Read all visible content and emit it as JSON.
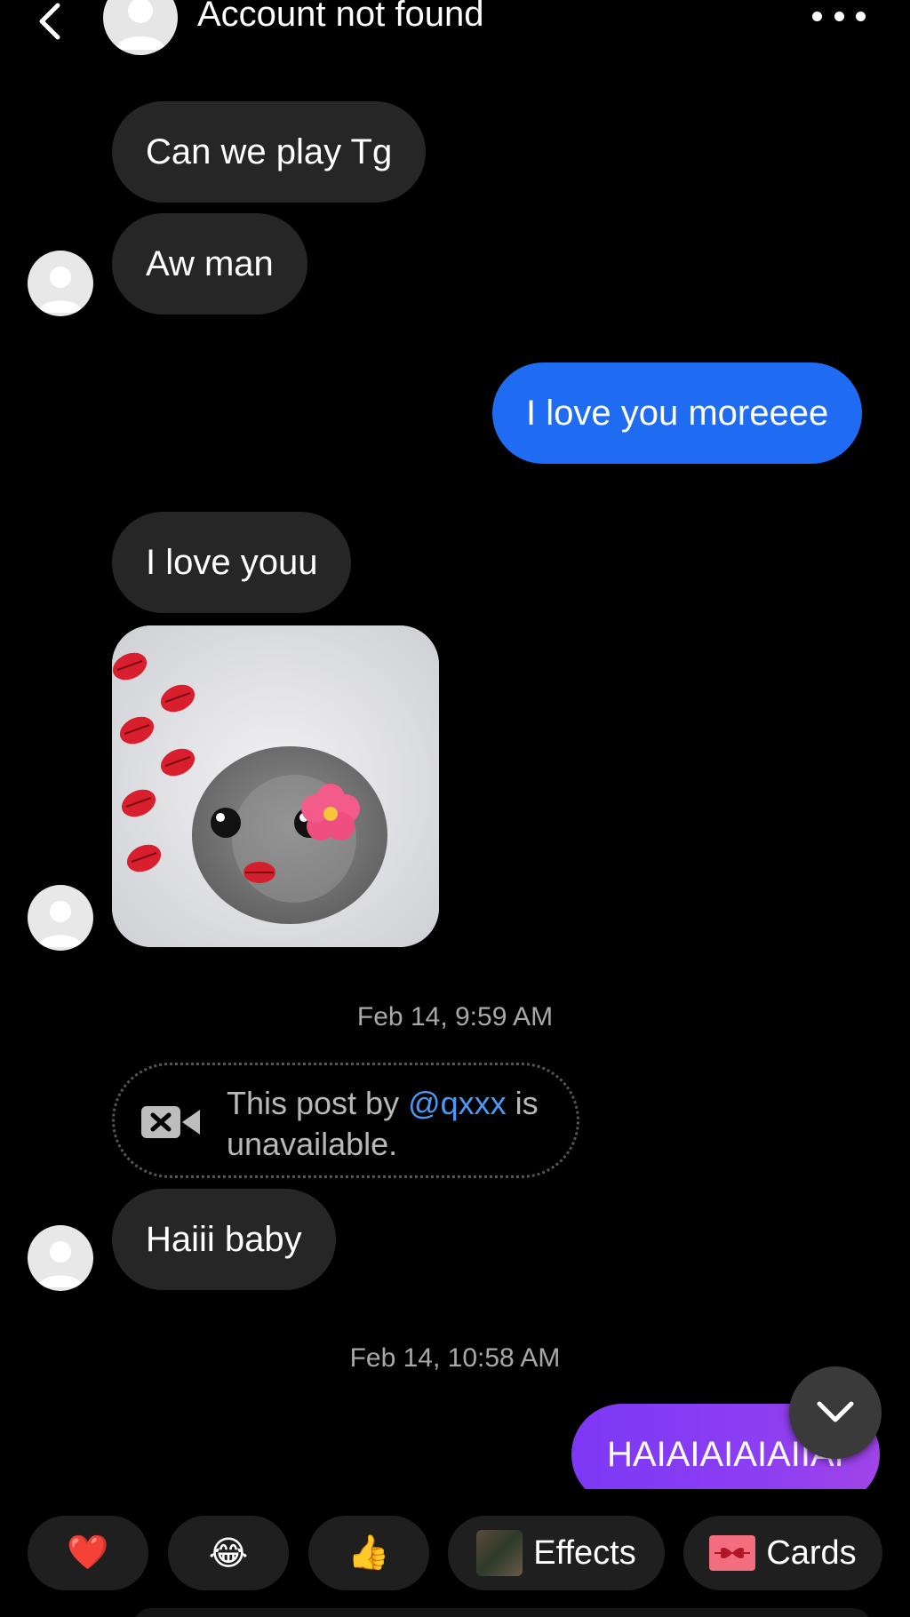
{
  "header": {
    "title": "Account not found",
    "back_icon": "chevron-left-icon",
    "more_icon": "more-horizontal-icon"
  },
  "messages": [
    {
      "direction": "in",
      "type": "text",
      "text": "Can we play Tg"
    },
    {
      "direction": "in",
      "type": "text",
      "text": "Aw man"
    },
    {
      "direction": "out",
      "type": "text",
      "text": "I love you moreeee"
    },
    {
      "direction": "in",
      "type": "text",
      "text": "I love youu"
    },
    {
      "direction": "in",
      "type": "sticker",
      "sticker": "hamster-kiss-sticker"
    }
  ],
  "timestamp_1": "Feb 14, 9:59 AM",
  "unavailable_post": {
    "prefix": "This post by ",
    "mention": "@qxxx",
    "suffix": " is unavailable.",
    "icon": "video-off-icon"
  },
  "message_after_post": {
    "direction": "in",
    "type": "text",
    "text": "Haiii baby"
  },
  "timestamp_2": "Feb 14, 10:58 AM",
  "last_message": {
    "direction": "out",
    "type": "text",
    "text": "HAIAIAIAIAIIAI"
  },
  "quick_bar": {
    "heart": "❤️",
    "laugh": "😂",
    "thumbs": "👍",
    "effects_label": "Effects",
    "cards_label": "Cards"
  },
  "colors": {
    "background": "#000000",
    "incoming_bubble": "#262626",
    "outgoing_bubble": "#1f6cf2",
    "outgoing_gradient_start": "#7d38f5",
    "mention": "#4a9af5"
  }
}
